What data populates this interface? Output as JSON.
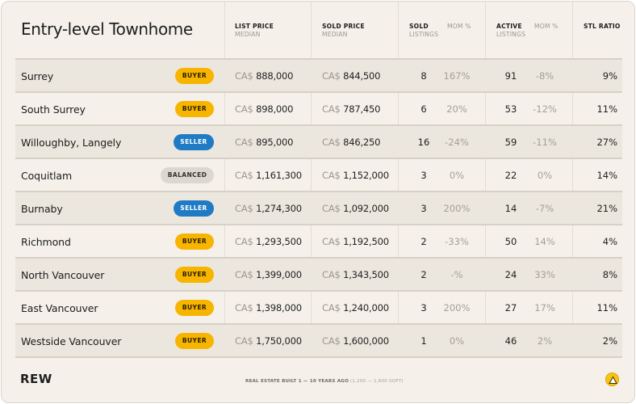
{
  "title": "Entry-level Townhome",
  "headers": {
    "list_price": "LIST PRICE",
    "list_price_sub": "MEDIAN",
    "sold_price": "SOLD PRICE",
    "sold_price_sub": "MEDIAN",
    "sold": "SOLD",
    "sold_sub": "LISTINGS",
    "sold_mom": "MOM %",
    "active": "ACTIVE",
    "active_sub": "LISTINGS",
    "active_mom": "MOM %",
    "stl": "STL RATIO"
  },
  "currency": "CA$",
  "rows": [
    {
      "area": "Surrey",
      "market": "BUYER",
      "list": "888,000",
      "sold_price": "844,500",
      "sold": "8",
      "sold_mom": "167%",
      "active": "91",
      "active_mom": "-8%",
      "stl": "9%"
    },
    {
      "area": "South Surrey",
      "market": "BUYER",
      "list": "898,000",
      "sold_price": "787,450",
      "sold": "6",
      "sold_mom": "20%",
      "active": "53",
      "active_mom": "-12%",
      "stl": "11%"
    },
    {
      "area": "Willoughby, Langely",
      "market": "SELLER",
      "list": "895,000",
      "sold_price": "846,250",
      "sold": "16",
      "sold_mom": "-24%",
      "active": "59",
      "active_mom": "-11%",
      "stl": "27%"
    },
    {
      "area": "Coquitlam",
      "market": "BALANCED",
      "list": "1,161,300",
      "sold_price": "1,152,000",
      "sold": "3",
      "sold_mom": "0%",
      "active": "22",
      "active_mom": "0%",
      "stl": "14%"
    },
    {
      "area": "Burnaby",
      "market": "SELLER",
      "list": "1,274,300",
      "sold_price": "1,092,000",
      "sold": "3",
      "sold_mom": "200%",
      "active": "14",
      "active_mom": "-7%",
      "stl": "21%"
    },
    {
      "area": "Richmond",
      "market": "BUYER",
      "list": "1,293,500",
      "sold_price": "1,192,500",
      "sold": "2",
      "sold_mom": "-33%",
      "active": "50",
      "active_mom": "14%",
      "stl": "4%"
    },
    {
      "area": "North Vancouver",
      "market": "BUYER",
      "list": "1,399,000",
      "sold_price": "1,343,500",
      "sold": "2",
      "sold_mom": "-%",
      "active": "24",
      "active_mom": "33%",
      "stl": "8%"
    },
    {
      "area": "East Vancouver",
      "market": "BUYER",
      "list": "1,398,000",
      "sold_price": "1,240,000",
      "sold": "3",
      "sold_mom": "200%",
      "active": "27",
      "active_mom": "17%",
      "stl": "11%"
    },
    {
      "area": "Westside Vancouver",
      "market": "BUYER",
      "list": "1,750,000",
      "sold_price": "1,600,000",
      "sold": "1",
      "sold_mom": "0%",
      "active": "46",
      "active_mom": "2%",
      "stl": "2%"
    }
  ],
  "footer": {
    "logo": "REW",
    "note_main": "REAL ESTATE BUILT 1 — 10 YEARS AGO",
    "note_sub": "(1,200 — 1,600 SQFT)",
    "corner_icon": "triangle-badge-icon"
  },
  "colors": {
    "background": "#f5f1ea",
    "row_alt": "#ece7de",
    "buyer": "#f7b500",
    "seller": "#1e7bc4",
    "balanced": "#dcd7cf",
    "muted_text": "#9d968c"
  }
}
